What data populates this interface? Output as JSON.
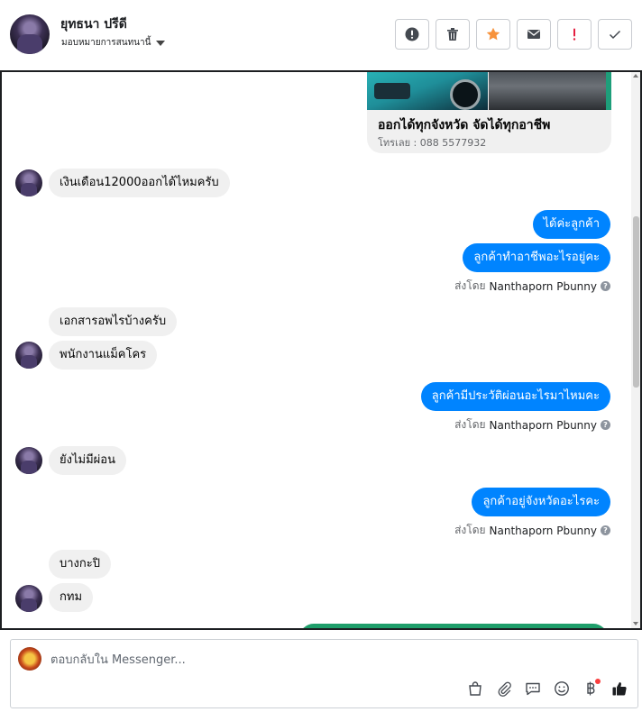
{
  "header": {
    "user_name": "ยุทธนา ปรีดี",
    "assign_label": "มอบหมายการสนทนานี้",
    "actions": [
      {
        "name": "report-spam",
        "icon": "exclamation-circle-icon"
      },
      {
        "name": "delete",
        "icon": "trash-icon"
      },
      {
        "name": "star",
        "icon": "star-icon"
      },
      {
        "name": "mark-unread",
        "icon": "envelope-icon"
      },
      {
        "name": "flag-important",
        "icon": "exclamation-icon"
      },
      {
        "name": "mark-done",
        "icon": "checkmark-icon"
      }
    ]
  },
  "ad_card": {
    "title": "ออกได้ทุกจังหวัด จัดได้ทุกอาชีพ",
    "subtitle": "โทรเลย : 088 5577932"
  },
  "messages": [
    {
      "dir": "in",
      "text": "เงินเดือน12000ออกได้ไหมครับ",
      "avatar": true
    },
    {
      "dir": "out",
      "text": "ได้ค่ะลูกค้า"
    },
    {
      "dir": "out",
      "text": "ลูกค้าทำอาชีพอะไรอยู่คะ"
    },
    {
      "dir": "meta",
      "prefix": "ส่งโดย",
      "agent": "Nanthaporn Pbunny"
    },
    {
      "dir": "in",
      "text": "เอกสารอพไรบ้างครับ"
    },
    {
      "dir": "in",
      "text": "พนักงานแม็คโคร",
      "avatar": true
    },
    {
      "dir": "out",
      "text": "ลูกค้ามีประวัติผ่อนอะไรมาไหมคะ"
    },
    {
      "dir": "meta",
      "prefix": "ส่งโดย",
      "agent": "Nanthaporn Pbunny"
    },
    {
      "dir": "in",
      "text": "ยังไม่มีผ่อน",
      "avatar": true
    },
    {
      "dir": "out",
      "text": "ลูกค้าอยู่จังหวัดอะไรคะ"
    },
    {
      "dir": "meta",
      "prefix": "ส่งโดย",
      "agent": "Nanthaporn Pbunny"
    },
    {
      "dir": "in",
      "text": "บางกะปิ"
    },
    {
      "dir": "in",
      "text": "กทม",
      "avatar": true
    }
  ],
  "composer": {
    "placeholder": "ตอบกลับใน Messenger...",
    "tools": [
      "bag-icon",
      "paperclip-icon",
      "saved-reply-icon",
      "emoji-icon",
      "baht-payment-icon",
      "thumbs-up-icon"
    ]
  },
  "colors": {
    "outgoing_bubble": "#0084ff",
    "incoming_bubble": "#f0f0f0",
    "star": "#f7923b",
    "important": "#e41e3f"
  }
}
